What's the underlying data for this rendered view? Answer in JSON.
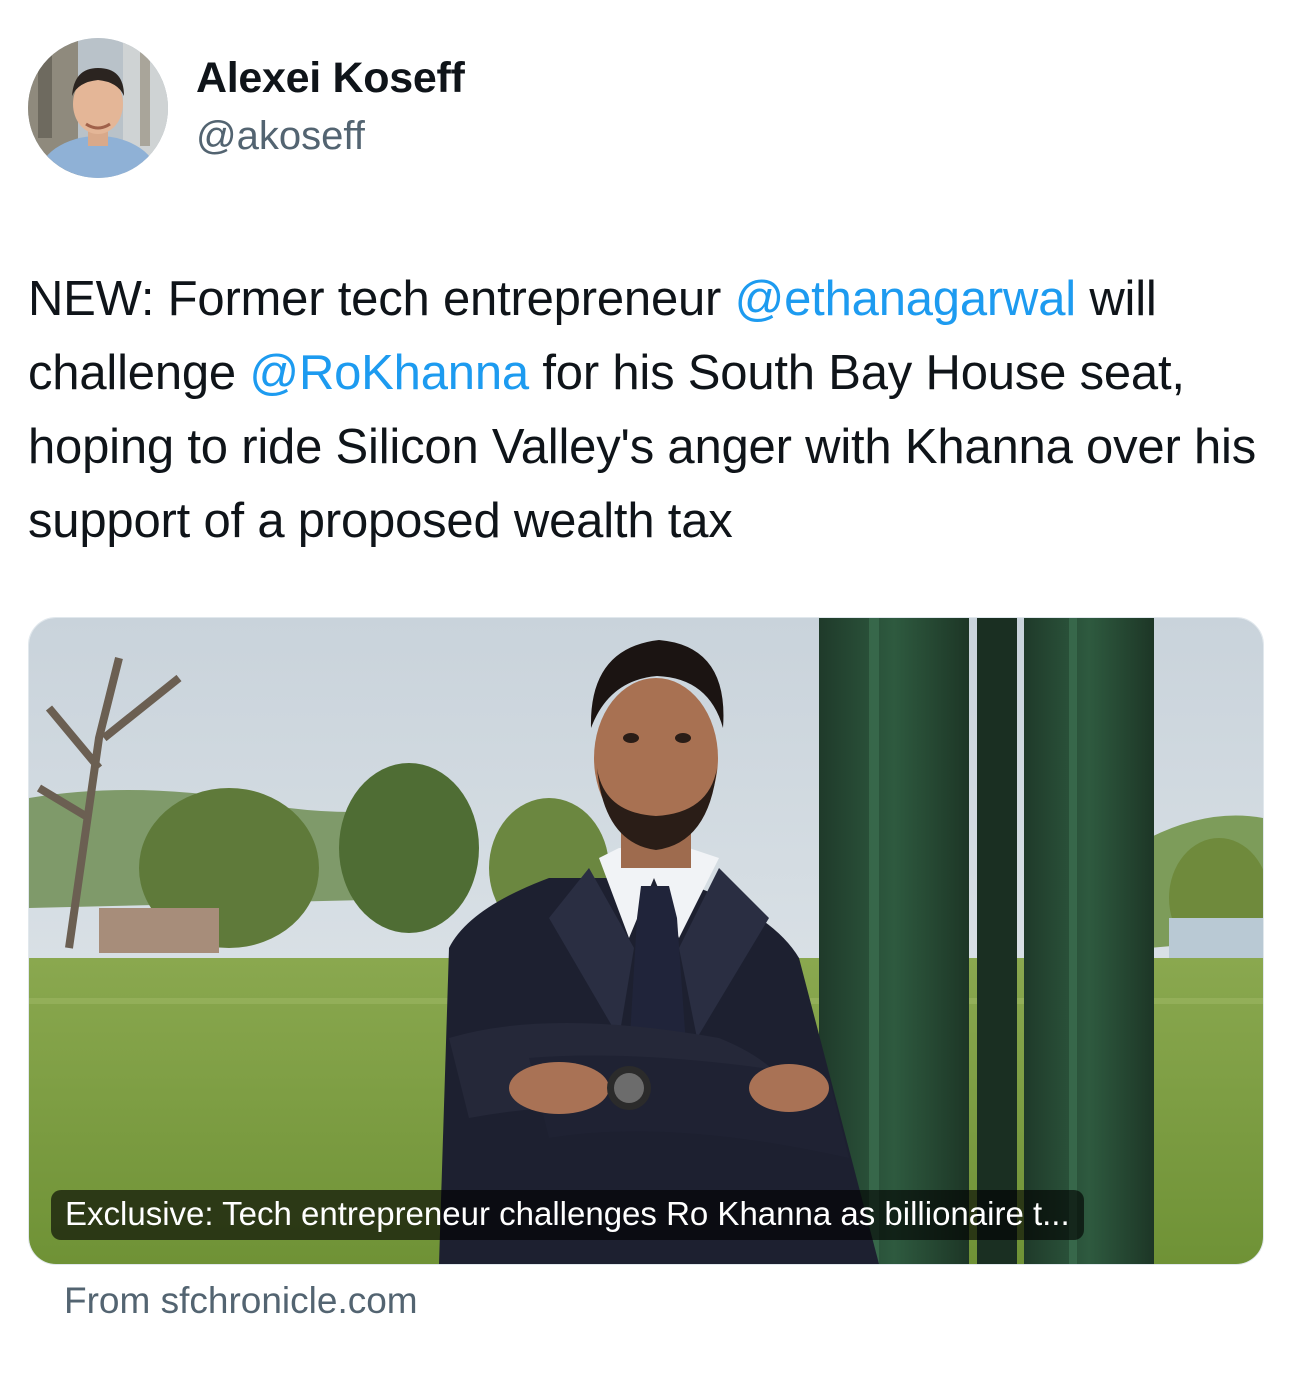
{
  "author": {
    "name": "Alexei Koseff",
    "handle": "@akoseff"
  },
  "tweet": {
    "segments": [
      {
        "text": "NEW: Former tech entrepreneur ",
        "kind": "text"
      },
      {
        "text": "@ethanagarwal",
        "kind": "mention"
      },
      {
        "text": " will challenge ",
        "kind": "text"
      },
      {
        "text": "@RoKhanna",
        "kind": "mention"
      },
      {
        "text": " for his South Bay House seat, hoping to ride Silicon Valley's anger with Khanna over his support of a proposed wealth tax",
        "kind": "text"
      }
    ]
  },
  "card": {
    "caption": "Exclusive: Tech entrepreneur challenges Ro Khanna as billionaire t...",
    "source": "From sfchronicle.com",
    "image_icon": "article-photo"
  },
  "colors": {
    "text": "#0f1419",
    "secondary": "#536471",
    "link": "#1d9bf0"
  }
}
